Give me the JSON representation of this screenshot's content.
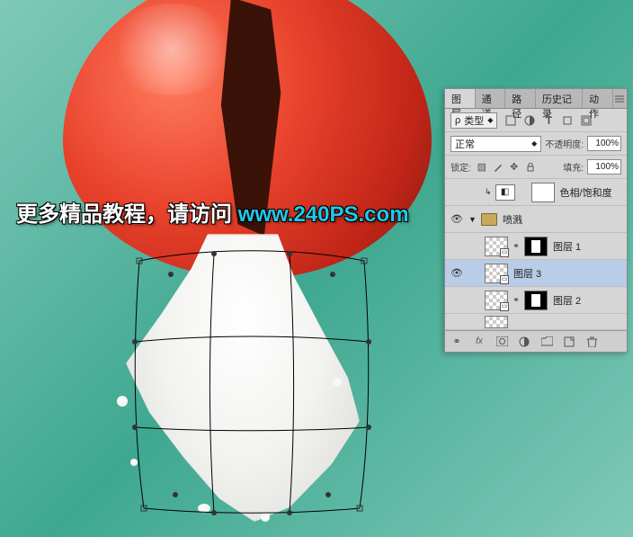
{
  "overlay": {
    "text_cn": "更多精品教程，请访问 ",
    "url": "www.240PS.com"
  },
  "panel": {
    "tabs": [
      "图层",
      "通道",
      "路径",
      "历史记录",
      "动作"
    ],
    "active_tab": 0,
    "kind_label": "类型",
    "blend_mode": "正常",
    "opacity_label": "不透明度:",
    "opacity_value": "100%",
    "lock_label": "锁定:",
    "fill_label": "填充:",
    "fill_value": "100%",
    "layers": {
      "adjustment": "色相/饱和度",
      "group": "喷溅",
      "layer1": "图层 1",
      "layer3": "图层 3",
      "layer2": "图层 2"
    }
  }
}
